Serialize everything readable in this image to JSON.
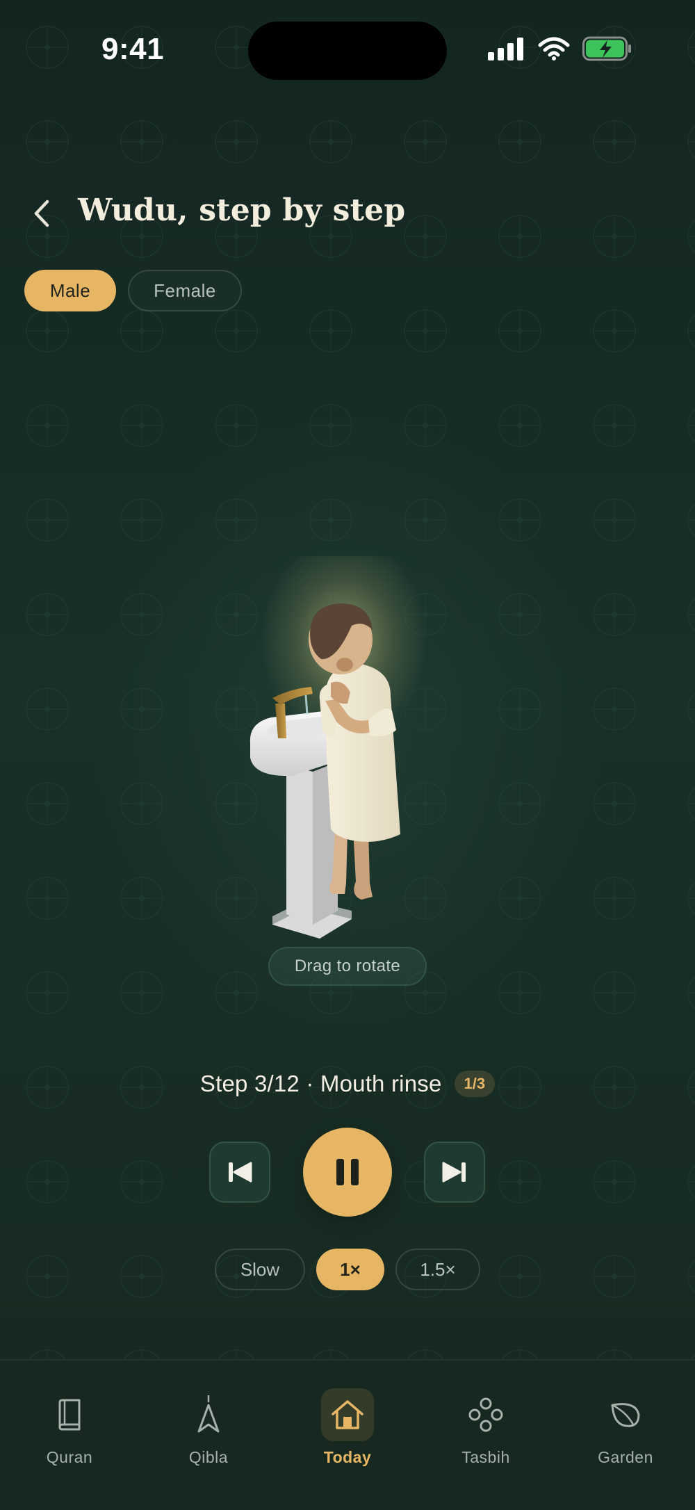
{
  "status_bar": {
    "time": "9:41"
  },
  "header": {
    "title": "Wudu, step by step"
  },
  "gender": {
    "options": [
      "Male",
      "Female"
    ],
    "selected": "Male"
  },
  "scene": {
    "hint": "Drag to rotate"
  },
  "step": {
    "label": "Step 3/12 · Mouth rinse",
    "repeat_badge": "1/3"
  },
  "playback": {
    "state": "playing"
  },
  "speed": {
    "options": [
      "Slow",
      "1×",
      "1.5×"
    ],
    "selected": "1×"
  },
  "tabs": [
    {
      "label": "Quran",
      "icon": "book-icon"
    },
    {
      "label": "Qibla",
      "icon": "compass-icon"
    },
    {
      "label": "Today",
      "icon": "home-icon",
      "active": true
    },
    {
      "label": "Tasbih",
      "icon": "beads-icon"
    },
    {
      "label": "Garden",
      "icon": "leaf-icon"
    }
  ],
  "colors": {
    "accent": "#e6b665",
    "background": "#15241f"
  }
}
